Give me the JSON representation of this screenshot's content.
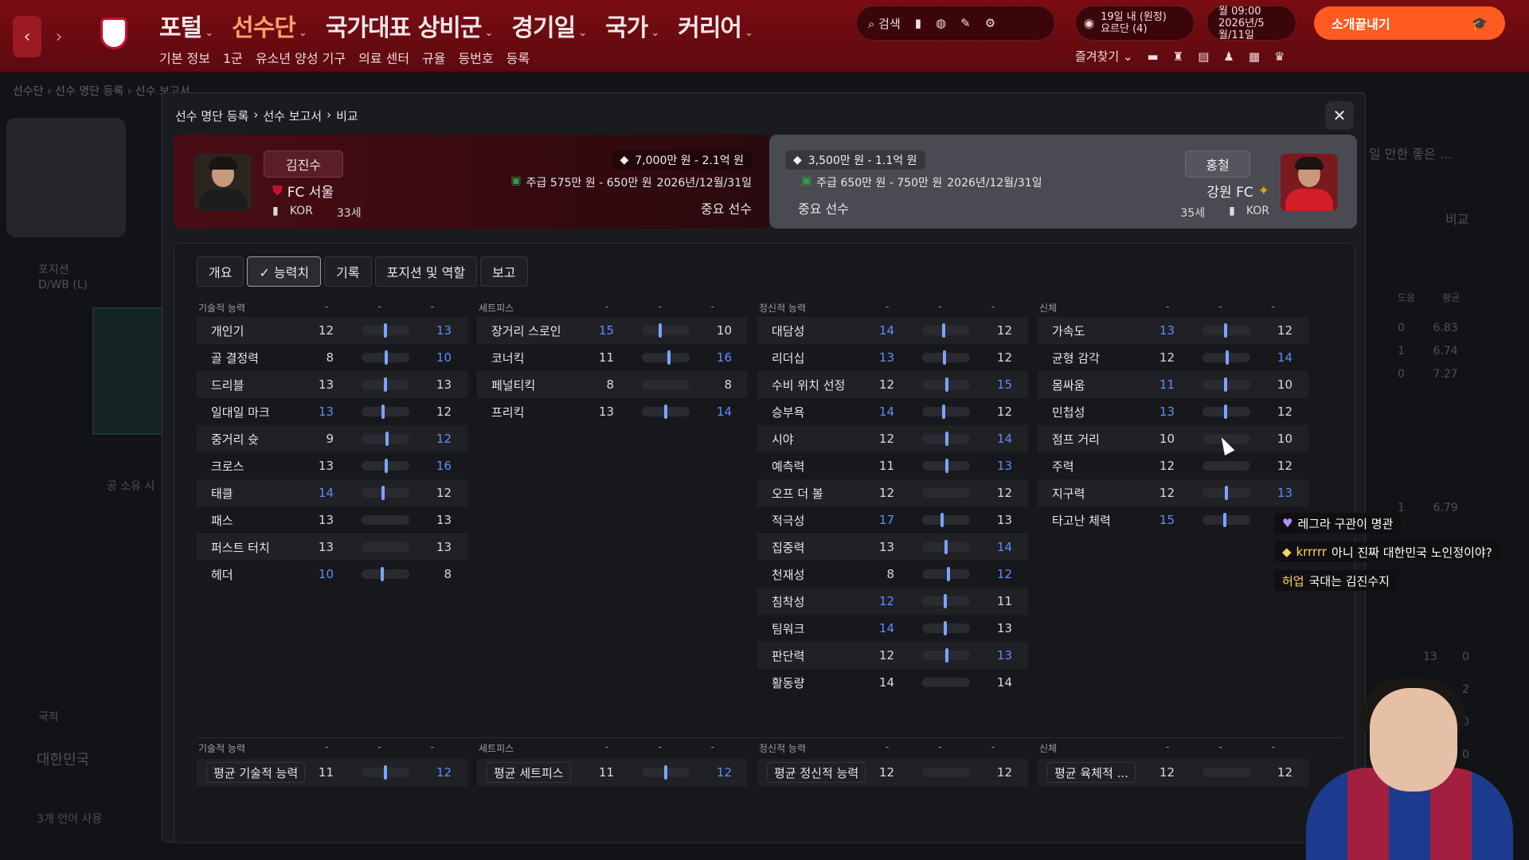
{
  "topbar": {
    "menu": [
      "포털",
      "선수단",
      "국가대표 상비군",
      "경기일",
      "국가",
      "커리어"
    ],
    "active_menu": "선수단",
    "submenu": [
      "기본 정보",
      "1군",
      "유소년 양성 기구",
      "의료 센터",
      "규율",
      "등번호",
      "등록"
    ],
    "search_label": "검색",
    "date_line1": "19일 내 (원정)",
    "date_line2": "요르단 (4)",
    "time_line1": "월 09:00",
    "time_line2": "2026년/5월/11일",
    "cta_label": "소개끝내기",
    "favorites_label": "즐겨찾기"
  },
  "background": {
    "breadcrumb": "선수단 › 선수 명단 등록 › 선수 보고서",
    "position_label": "포지션",
    "position_value": "D/WB (L)",
    "country_label": "국적",
    "country_value": "대한민국",
    "language_text": "3개 언어 사용",
    "filter_label": "공 소유 시",
    "right_text": "일 만한 좋은 ...",
    "compare_label": "비교",
    "right_header": [
      "도움",
      "평균"
    ],
    "right_rows": [
      [
        "0",
        "6.83"
      ],
      [
        "1",
        "6.74"
      ],
      [
        "0",
        "7.27"
      ],
      [
        "1",
        "6.79"
      ]
    ],
    "right_bottom": [
      [
        "13",
        "0"
      ],
      [
        "37",
        "2"
      ],
      [
        "",
        "0"
      ],
      [
        "",
        "0"
      ],
      [
        "",
        "0"
      ]
    ]
  },
  "modal": {
    "breadcrumb": [
      "선수 명단 등록",
      "선수 보고서",
      "비교"
    ],
    "close_label": "✕",
    "left_player": {
      "name": "김진수",
      "club": "FC 서울",
      "nation": "KOR",
      "age": "33세",
      "value": "7,000만 원 - 2.1억 원",
      "wage": "주급 575만 원 - 650만 원",
      "contract": "2026년/12월/31일",
      "role": "중요 선수"
    },
    "right_player": {
      "name": "홍철",
      "club": "강원 FC",
      "nation": "KOR",
      "age": "35세",
      "value": "3,500만 원 - 1.1억 원",
      "wage": "주급 650만 원 - 750만 원",
      "contract": "2026년/12월/31일",
      "role": "중요 선수"
    },
    "tabs": [
      "개요",
      "✓ 능력치",
      "기록",
      "포지션 및 역할",
      "보고"
    ],
    "active_tab": 1,
    "columns": [
      {
        "title": "기술적 능력",
        "rows": [
          {
            "label": "개인기",
            "left": "12",
            "right": "13",
            "hl": "r",
            "bar": 0.5
          },
          {
            "label": "골 결정력",
            "left": "8",
            "right": "10",
            "hl": "r",
            "bar": 0.52
          },
          {
            "label": "드리블",
            "left": "13",
            "right": "13",
            "hl": "",
            "bar": 0.5
          },
          {
            "label": "일대일 마크",
            "left": "13",
            "right": "12",
            "hl": "l",
            "bar": 0.45
          },
          {
            "label": "중거리 슛",
            "left": "9",
            "right": "12",
            "hl": "r",
            "bar": 0.53
          },
          {
            "label": "크로스",
            "left": "13",
            "right": "16",
            "hl": "r",
            "bar": 0.51
          },
          {
            "label": "태클",
            "left": "14",
            "right": "12",
            "hl": "l",
            "bar": 0.45
          },
          {
            "label": "패스",
            "left": "13",
            "right": "13",
            "hl": "",
            "bar": null
          },
          {
            "label": "퍼스트 터치",
            "left": "13",
            "right": "13",
            "hl": "",
            "bar": null
          },
          {
            "label": "헤더",
            "left": "10",
            "right": "8",
            "hl": "l",
            "bar": 0.43
          }
        ]
      },
      {
        "title": "세트피스",
        "rows": [
          {
            "label": "장거리 스로인",
            "left": "15",
            "right": "10",
            "hl": "l",
            "bar": 0.38
          },
          {
            "label": "코너킥",
            "left": "11",
            "right": "16",
            "hl": "r",
            "bar": 0.56
          },
          {
            "label": "페널티킥",
            "left": "8",
            "right": "8",
            "hl": "",
            "bar": null
          },
          {
            "label": "프리킥",
            "left": "13",
            "right": "14",
            "hl": "r",
            "bar": 0.5
          }
        ]
      },
      {
        "title": "정신적 능력",
        "rows": [
          {
            "label": "대담성",
            "left": "14",
            "right": "12",
            "hl": "l",
            "bar": 0.45
          },
          {
            "label": "리더십",
            "left": "13",
            "right": "12",
            "hl": "l",
            "bar": 0.47
          },
          {
            "label": "수비 위치 선정",
            "left": "12",
            "right": "15",
            "hl": "r",
            "bar": 0.52
          },
          {
            "label": "승부욕",
            "left": "14",
            "right": "12",
            "hl": "l",
            "bar": 0.45
          },
          {
            "label": "시야",
            "left": "12",
            "right": "14",
            "hl": "r",
            "bar": 0.52
          },
          {
            "label": "예측력",
            "left": "11",
            "right": "13",
            "hl": "r",
            "bar": 0.52
          },
          {
            "label": "오프 더 볼",
            "left": "12",
            "right": "12",
            "hl": "",
            "bar": null
          },
          {
            "label": "적극성",
            "left": "17",
            "right": "13",
            "hl": "l",
            "bar": 0.42
          },
          {
            "label": "집중력",
            "left": "13",
            "right": "14",
            "hl": "r",
            "bar": 0.5
          },
          {
            "label": "천재성",
            "left": "8",
            "right": "12",
            "hl": "r",
            "bar": 0.55
          },
          {
            "label": "침착성",
            "left": "12",
            "right": "11",
            "hl": "l",
            "bar": 0.48
          },
          {
            "label": "팀워크",
            "left": "14",
            "right": "13",
            "hl": "l",
            "bar": 0.48
          },
          {
            "label": "판단력",
            "left": "12",
            "right": "13",
            "hl": "r",
            "bar": 0.51
          },
          {
            "label": "활동량",
            "left": "14",
            "right": "14",
            "hl": "",
            "bar": null
          }
        ]
      },
      {
        "title": "신체",
        "rows": [
          {
            "label": "가속도",
            "left": "13",
            "right": "12",
            "hl": "l",
            "bar": 0.48
          },
          {
            "label": "균형 감각",
            "left": "12",
            "right": "14",
            "hl": "r",
            "bar": 0.51
          },
          {
            "label": "몸싸움",
            "left": "11",
            "right": "10",
            "hl": "l",
            "bar": 0.48
          },
          {
            "label": "민첩성",
            "left": "13",
            "right": "12",
            "hl": "l",
            "bar": 0.48
          },
          {
            "label": "점프 거리",
            "left": "10",
            "right": "10",
            "hl": "",
            "bar": null
          },
          {
            "label": "주력",
            "left": "12",
            "right": "12",
            "hl": "",
            "bar": null
          },
          {
            "label": "지구력",
            "left": "12",
            "right": "13",
            "hl": "r",
            "bar": 0.5
          },
          {
            "label": "타고난 체력",
            "left": "15",
            "right": "13",
            "hl": "l",
            "bar": 0.47
          }
        ]
      }
    ],
    "averages": [
      {
        "title": "기술적 능력",
        "label": "평균 기술적 능력",
        "left": "11",
        "right": "12",
        "hl": "r",
        "bar": 0.5
      },
      {
        "title": "세트피스",
        "label": "평균 세트피스",
        "left": "11",
        "right": "12",
        "hl": "r",
        "bar": 0.5
      },
      {
        "title": "정신적 능력",
        "label": "평균 정신적 능력",
        "left": "12",
        "right": "12",
        "hl": "",
        "bar": null
      },
      {
        "title": "신체",
        "label": "평균 육체적 ...",
        "left": "12",
        "right": "12",
        "hl": "",
        "bar": null
      }
    ]
  },
  "chat": [
    {
      "user": "",
      "text": "레그라 구관이 명관"
    },
    {
      "user": "krrrrr",
      "text": "아니 진짜 대한민국 노인정이야?"
    },
    {
      "user": "허업",
      "text": "국대는 김진수지"
    }
  ],
  "colors": {
    "accent": "#ff5a1f",
    "brand": "#7a0c12",
    "highlight": "#5f8bff"
  }
}
